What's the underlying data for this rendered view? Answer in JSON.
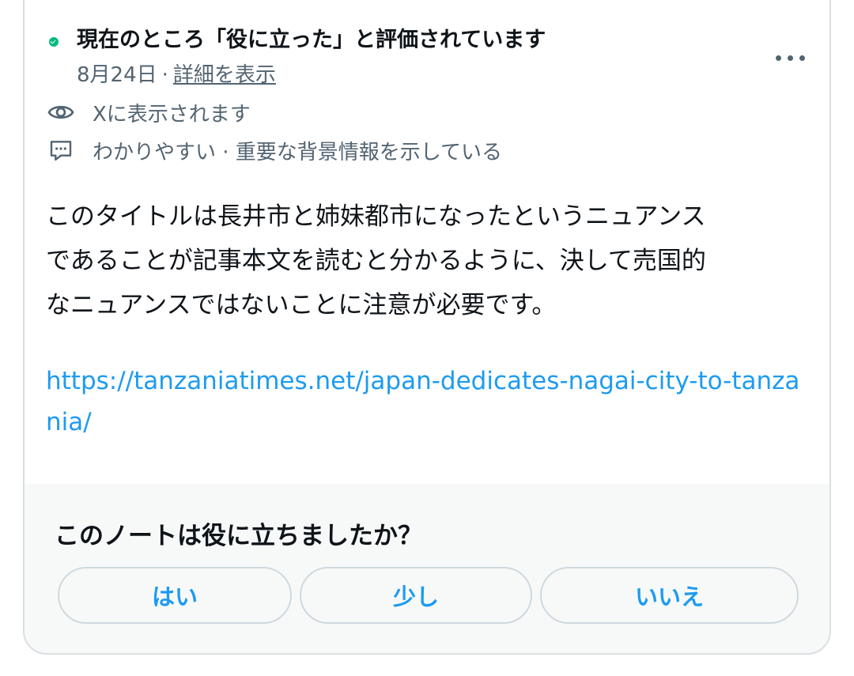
{
  "note": {
    "status": "現在のところ「役に立った」と評価されています",
    "date": "8月24日",
    "separator": "·",
    "details_link": "詳細を表示",
    "visibility": "Xに表示されます",
    "tags": "わかりやすい · 重要な背景情報を示している",
    "body": "このタイトルは長井市と姉妹都市になったというニュアンス\nであることが記事本文を読むと分かるように、決して売国的\nなニュアンスではないことに注意が必要です。",
    "url": "https://tanzaniatimes.net/japan-dedicates-nagai-city-to-tanzania/"
  },
  "rating": {
    "question": "このノートは役に立ちましたか？",
    "yes": "はい",
    "somewhat": "少し",
    "no": "いいえ"
  },
  "colors": {
    "accent": "#1d9bf0",
    "status_green": "#00ba7c",
    "secondary_text": "#536471",
    "primary_text": "#0f1419",
    "footer_bg": "#f7f9f9"
  },
  "icons": [
    "checkmark-circle-icon",
    "more-icon",
    "eye-icon",
    "comment-icon"
  ]
}
